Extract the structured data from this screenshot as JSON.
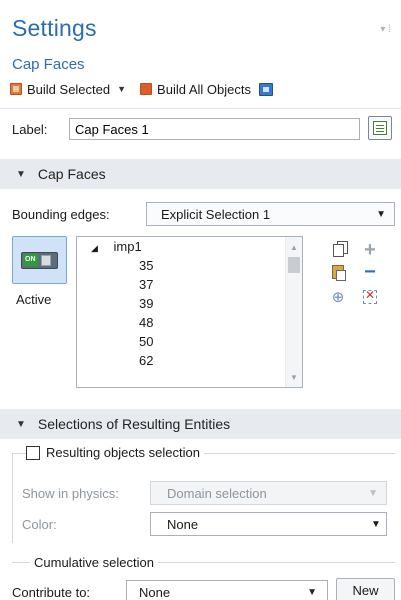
{
  "header": {
    "title": "Settings",
    "subtitle": "Cap Faces",
    "pin_icons": "▾ ⁞"
  },
  "toolbar": {
    "build_selected_label": "Build Selected",
    "build_all_label": "Build All Objects"
  },
  "label_row": {
    "label": "Label:",
    "value": "Cap Faces 1"
  },
  "sections": {
    "cap_faces": "Cap Faces",
    "resulting": "Selections of Resulting Entities"
  },
  "bounding": {
    "label": "Bounding edges:",
    "selected": "Explicit Selection 1"
  },
  "active": {
    "toggle_text": "ON",
    "label": "Active"
  },
  "list": {
    "group": "imp1",
    "items": [
      "35",
      "37",
      "39",
      "48",
      "50",
      "62"
    ]
  },
  "resulting": {
    "checkbox_label": "Resulting objects selection",
    "show_label": "Show in physics:",
    "show_value": "Domain selection",
    "color_label": "Color:",
    "color_value": "None"
  },
  "cumulative": {
    "label": "Cumulative selection",
    "contribute_label": "Contribute to:",
    "contribute_value": "None",
    "new_button": "New"
  }
}
